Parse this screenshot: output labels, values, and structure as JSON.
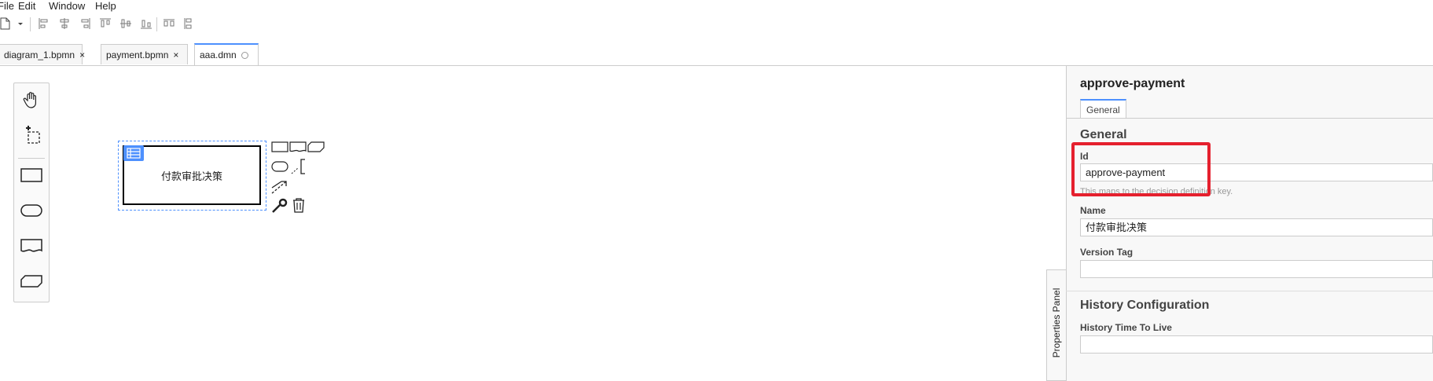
{
  "menu": {
    "file": "File",
    "edit": "Edit",
    "window": "Window",
    "help": "Help"
  },
  "toolbar": {
    "icons": [
      "new-file-icon",
      "dropdown-arrow-icon",
      "align-left-icon",
      "align-center-icon",
      "align-right-icon",
      "align-top-icon",
      "align-middle-icon",
      "align-bottom-icon",
      "distribute-horizontal-icon",
      "distribute-vertical-icon"
    ]
  },
  "tabs": [
    {
      "label": "diagram_1.bpmn",
      "close": "×"
    },
    {
      "label": "payment.bpmn",
      "close": "×"
    },
    {
      "label": "aaa.dmn",
      "state": "unsaved-dot"
    }
  ],
  "palette": {
    "tools": [
      "hand-tool-icon",
      "lasso-tool-icon",
      "decision-icon",
      "input-data-icon",
      "knowledge-source-icon",
      "business-knowledge-model-icon"
    ]
  },
  "diagram": {
    "decision_label": "付款审批决策"
  },
  "properties": {
    "title": "approve-payment",
    "tab": "General",
    "general_heading": "General",
    "id_label": "Id",
    "id_value": "approve-payment",
    "id_desc": "This maps to the decision definition key.",
    "name_label": "Name",
    "name_value": "付款审批决策",
    "version_label": "Version Tag",
    "version_value": "",
    "history_heading": "History Configuration",
    "ttl_label": "History Time To Live",
    "ttl_value": "",
    "panel_toggle": "Properties Panel"
  },
  "colors": {
    "accent": "#4d90fe",
    "highlight": "#e5202e"
  }
}
